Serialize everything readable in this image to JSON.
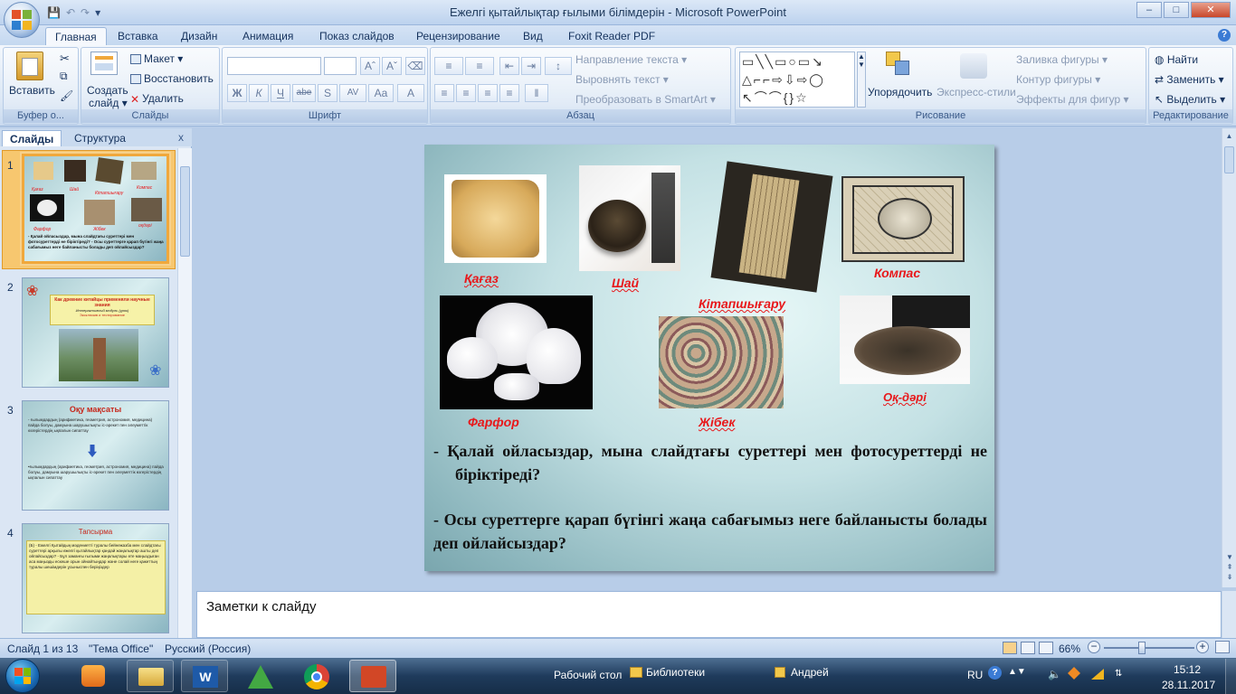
{
  "window": {
    "title": "Ежелгі қытайлықтар ғылыми білімдерін - Microsoft PowerPoint"
  },
  "ribbon_tabs": [
    "Главная",
    "Вставка",
    "Дизайн",
    "Анимация",
    "Показ слайдов",
    "Рецензирование",
    "Вид",
    "Foxit Reader PDF"
  ],
  "ribbon": {
    "clipboard": {
      "label": "Буфер о...",
      "paste": "Вставить"
    },
    "slides": {
      "label": "Слайды",
      "create_line1": "Создать",
      "create_line2": "слайд ▾",
      "layout": "Макет ▾",
      "reset": "Восстановить",
      "delete": "Удалить"
    },
    "font": {
      "label": "Шрифт",
      "bold": "Ж",
      "italic": "К",
      "underline": "Ч",
      "strike": "abe",
      "shadow": "S",
      "spacing": "AV",
      "case": "Aa",
      "color": "A"
    },
    "paragraph": {
      "label": "Абзац",
      "direction": "Направление текста ▾",
      "align": "Выровнять текст ▾",
      "smartart": "Преобразовать в SmartArt ▾"
    },
    "drawing": {
      "label": "Рисование",
      "arrange": "Упорядочить",
      "quickstyles": "Экспресс-стили",
      "fill": "Заливка фигуры ▾",
      "outline": "Контур фигуры ▾",
      "effects": "Эффекты для фигур ▾"
    },
    "editing": {
      "label": "Редактирование",
      "find": "Найти",
      "replace": "Заменить ▾",
      "select": "Выделить ▾"
    }
  },
  "panel": {
    "tab_slides": "Слайды",
    "tab_outline": "Структура",
    "close": "x"
  },
  "thumbnails": [
    {
      "num": "1",
      "captions": [
        "Қағаз",
        "Шай",
        "Кітапшығару",
        "Компас",
        "Фарфор",
        "Жібек",
        "оқдәрі"
      ],
      "text": "- Қалай ойласыздар, мына слайдтағы суреттері мен фотосуреттерді не біріктіреді? - Осы суреттерге қарап бүгінгі жаңа сабағымыз неге байланысты болады деп ойлайсыздар?"
    },
    {
      "num": "2",
      "title": "Как древние китайцы применяли научные знания",
      "subtitle": "Интерактивный модуль (урок)",
      "extra": "Эксклюзив и тестирование"
    },
    {
      "num": "3",
      "title": "Оқу мақсаты",
      "para1": "- ғылымдардың (арифметика, геометрия, астрономия, медицина) пайда болуы, дамуына шарушылықты іс-әрекет пен әлеуметтік өзгерістердің ықпалын сипаттау",
      "para2": "•ғылымдардың (арифметика, геометрия, астрономия, медицина) пайда болуы, дамуына шарушылықты іс-әрекет пен әлеуметтік өзгерістердің ықпалын сипаттау"
    },
    {
      "num": "4",
      "title": "Тапсырма",
      "body": "(Б) - Ежелгі Қытайдың мәдениетті туралы бейнежазба мен слайдтағы суреттері арқылы ежелгі қытайлықтар қандай жаңалықтар ашты деп ойлайсыздар? - Бұл заманғы ғылыми жаңалықтары өте маңыздыған аса маңызды ескеше орын ойнайтыңдар және солай неге қажеттың туралы шешімдерін ұсыныспен беріңіздер"
    }
  ],
  "slide": {
    "captions": {
      "paper": "Қағаз",
      "tea": "Шай",
      "printing": "Кітапшығару",
      "compass": "Компас",
      "porcelain": "Фарфор",
      "silk": "Жібек",
      "gunpowder": "Оқ-дәрі"
    },
    "line1": "- Қалай ойласыздар, мына слайдтағы суреттері мен фотосуреттерді не біріктіреді?",
    "line2": "- Осы суреттерге қарап бүгінгі жаңа сабағымыз неге байланысты болады деп ойлайсыздар?"
  },
  "notes_placeholder": "Заметки к слайду",
  "status": {
    "slide": "Слайд 1 из 13",
    "theme": "\"Тема Office\"",
    "lang": "Русский (Россия)",
    "zoom": "66%",
    "zoom_fraction": 0.42
  },
  "taskbar": {
    "desktop": "Рабочий стол",
    "libraries": "Библиотеки",
    "user": "Андрей",
    "lang": "RU",
    "time": "15:12",
    "date": "28.11.2017"
  },
  "colors": {
    "accent": "#f0a83c",
    "caption_red": "#e8181b",
    "ribbon": "#dbe7f5"
  }
}
